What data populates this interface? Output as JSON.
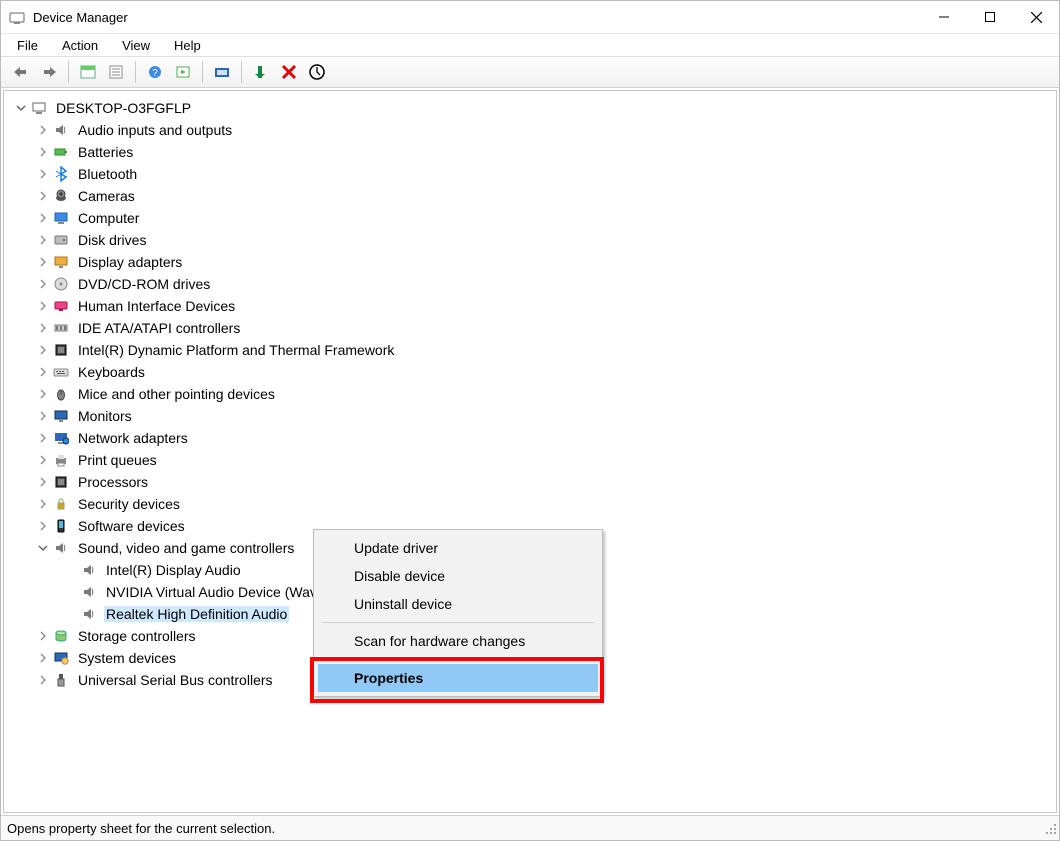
{
  "window_title": "Device Manager",
  "menu": {
    "file": "File",
    "action": "Action",
    "view": "View",
    "help": "Help"
  },
  "tree": {
    "root": "DESKTOP-O3FGFLP",
    "categories": [
      {
        "label": "Audio inputs and outputs",
        "icon": "speaker"
      },
      {
        "label": "Batteries",
        "icon": "battery"
      },
      {
        "label": "Bluetooth",
        "icon": "bluetooth"
      },
      {
        "label": "Cameras",
        "icon": "camera"
      },
      {
        "label": "Computer",
        "icon": "computer"
      },
      {
        "label": "Disk drives",
        "icon": "disk"
      },
      {
        "label": "Display adapters",
        "icon": "display"
      },
      {
        "label": "DVD/CD-ROM drives",
        "icon": "cdrom"
      },
      {
        "label": "Human Interface Devices",
        "icon": "hid"
      },
      {
        "label": "IDE ATA/ATAPI controllers",
        "icon": "ide"
      },
      {
        "label": "Intel(R) Dynamic Platform and Thermal Framework",
        "icon": "cpu"
      },
      {
        "label": "Keyboards",
        "icon": "keyboard"
      },
      {
        "label": "Mice and other pointing devices",
        "icon": "mouse"
      },
      {
        "label": "Monitors",
        "icon": "monitor"
      },
      {
        "label": "Network adapters",
        "icon": "network"
      },
      {
        "label": "Print queues",
        "icon": "printer"
      },
      {
        "label": "Processors",
        "icon": "cpu"
      },
      {
        "label": "Security devices",
        "icon": "security"
      },
      {
        "label": "Software devices",
        "icon": "software"
      },
      {
        "label": "Sound, video and game controllers",
        "icon": "speaker",
        "expanded": true
      }
    ],
    "sound_children": [
      {
        "label": "Intel(R) Display Audio",
        "icon": "speaker"
      },
      {
        "label": "NVIDIA Virtual Audio Device (Wave Extensible) (WDM)",
        "icon": "speaker"
      },
      {
        "label": "Realtek High Definition Audio",
        "icon": "speaker",
        "selected": true
      }
    ],
    "after_sound": [
      {
        "label": "Storage controllers",
        "icon": "storage"
      },
      {
        "label": "System devices",
        "icon": "system"
      },
      {
        "label": "Universal Serial Bus controllers",
        "icon": "usb"
      }
    ]
  },
  "context_menu": {
    "items": [
      "Update driver",
      "Disable device",
      "Uninstall device"
    ],
    "scan": "Scan for hardware changes",
    "properties": "Properties"
  },
  "statusbar": "Opens property sheet for the current selection."
}
